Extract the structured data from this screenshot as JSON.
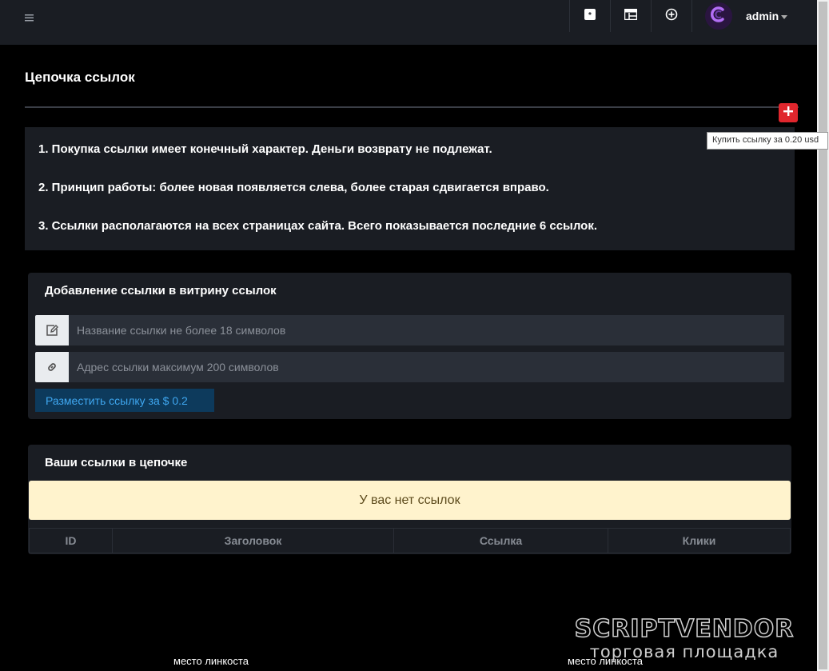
{
  "topbar": {
    "user_name": "admin",
    "icons": [
      "menu-icon",
      "asterisk-icon",
      "table-icon",
      "plus-circle-icon",
      "avatar-logo-icon"
    ]
  },
  "page": {
    "title": "Цепочка ссылок",
    "add_tooltip": "Купить ссылку за 0.20 usd"
  },
  "rules": [
    "1. Покупка ссылки имеет конечный характер. Деньги возврату не подлежат.",
    "2. Принцип работы: более новая появляется слева, более старая сдвигается вправо.",
    "3. Ссылки располагаются на всех страницах сайта. Всего показывается последние 6 ссылок."
  ],
  "add_form": {
    "title": "Добавление ссылки в витрину ссылок",
    "name_placeholder": "Название ссылки не более 18 символов",
    "url_placeholder": "Адрес ссылки максимум 200 символов",
    "submit_label": "Разместить ссылку за $ 0.2"
  },
  "my_links": {
    "title": "Ваши ссылки в цепочке",
    "empty_message": "У вас нет ссылок",
    "columns": [
      "ID",
      "Заголовок",
      "Ссылка",
      "Клики"
    ]
  },
  "footer": {
    "link_slots": [
      "место линкоста",
      "место линкоста"
    ]
  },
  "watermark": {
    "brand": "SCRIPTVENDOR",
    "tagline": "торговая площадка"
  },
  "colors": {
    "background": "#000000",
    "panel": "#1a1d23",
    "danger": "#e0262d",
    "warning_bg": "#fff3cd",
    "primary_text": "#3fa7f0"
  }
}
